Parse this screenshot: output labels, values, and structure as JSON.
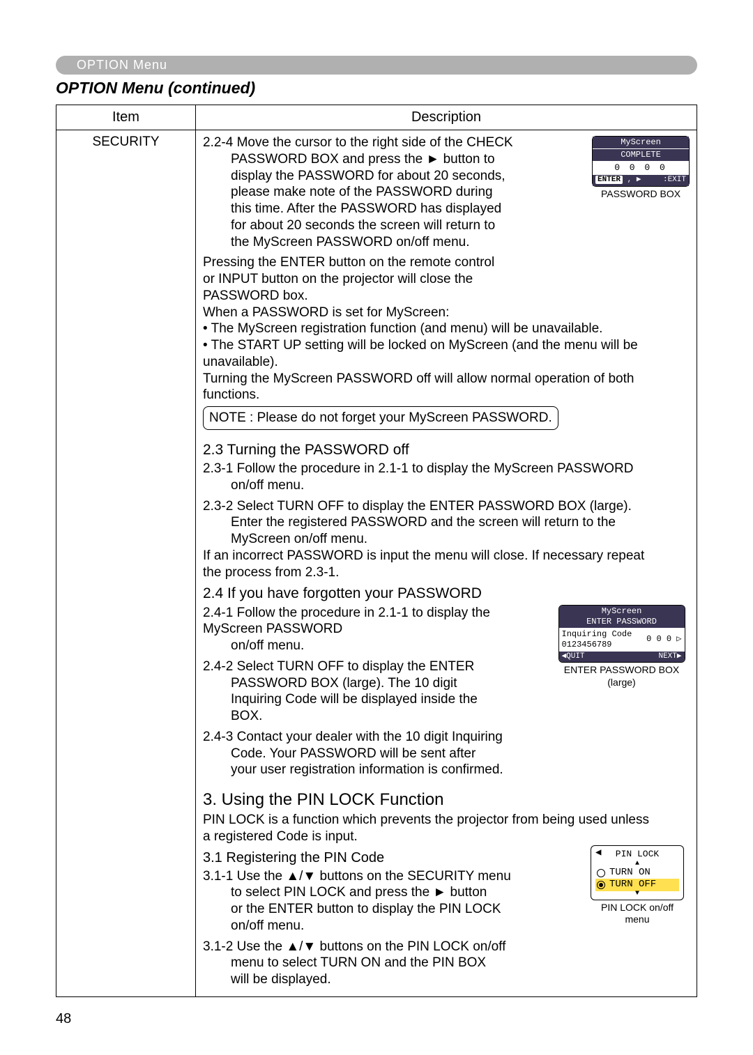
{
  "header": {
    "tab": "OPTION Menu",
    "title": "OPTION Menu (continued)"
  },
  "table": {
    "head_item": "Item",
    "head_desc": "Description",
    "item": "SECURITY"
  },
  "sec224": {
    "num": "2.2-4",
    "l1": "Move the cursor to the right side of the CHECK",
    "l2": "PASSWORD BOX and press the ► button to",
    "l3": "display the PASSWORD for about 20 seconds,",
    "l4": "please make note of the PASSWORD during",
    "l5": "this time. After the PASSWORD has displayed",
    "l6": "for about 20 seconds the screen will return to",
    "l7": "the MyScreen PASSWORD on/off menu.",
    "p2a": "Pressing the ENTER button on the remote control",
    "p2b": "or INPUT button on the projector will close the",
    "p2c": "PASSWORD box.",
    "p3": "When a PASSWORD is set for MyScreen:",
    "b1": "• The MyScreen registration function (and menu) will be unavailable.",
    "b2a": "• The START UP setting will be locked on MyScreen (and the menu will be",
    "b2b": "unavailable).",
    "p4a": "Turning the MyScreen PASSWORD off will allow normal operation of both",
    "p4b": "functions."
  },
  "note": "NOTE : Please do not forget your MyScreen PASSWORD.",
  "sec23": {
    "h": "2.3 Turning the PASSWORD off",
    "s1_num": "2.3-1",
    "s1a": "Follow the procedure in 2.1-1 to display the MyScreen PASSWORD",
    "s1b": "on/off menu.",
    "s2_num": "2.3-2",
    "s2a": "Select TURN OFF to display the ENTER PASSWORD BOX (large).",
    "s2b": "Enter the registered PASSWORD and the screen will return to the",
    "s2c": "MyScreen on/off menu.",
    "s2d": "If an incorrect PASSWORD is input the menu will close. If necessary repeat",
    "s2e": "the process from 2.3-1."
  },
  "sec24": {
    "h": "2.4 If you have forgotten your PASSWORD",
    "s1_num": "2.4-1",
    "s1a": "Follow the procedure in 2.1-1 to display the MyScreen PASSWORD",
    "s1b": "on/off menu.",
    "s2_num": "2.4-2",
    "s2a": "Select TURN OFF to display the ENTER",
    "s2b": "PASSWORD BOX (large). The 10 digit",
    "s2c": "Inquiring Code will be displayed inside the",
    "s2d": "BOX.",
    "s3_num": "2.4-3",
    "s3a": "Contact your dealer with the 10 digit Inquiring",
    "s3b": "Code. Your PASSWORD will be sent after",
    "s3c": "your user registration information is confirmed."
  },
  "sec3": {
    "h": "3. Using the PIN LOCK Function",
    "intro1": "PIN LOCK is a function which prevents the projector from being used unless",
    "intro2": "a registered Code is input.",
    "h31": "3.1 Registering the PIN Code",
    "s1_num": "3.1-1",
    "s1a": "Use the ▲/▼ buttons on the SECURITY menu",
    "s1b": "to select PIN LOCK and press the ► button",
    "s1c": "or the ENTER button to display the PIN LOCK",
    "s1d": "on/off menu.",
    "s2_num": "3.1-2",
    "s2a": "Use the ▲/▼ buttons on the PIN LOCK on/off",
    "s2b": "menu to select TURN ON and the PIN BOX",
    "s2c": "will be displayed."
  },
  "osd1": {
    "title": "MyScreen",
    "sub": "COMPLETE",
    "digits": "0  0  0  0",
    "enter": "ENTER",
    "exit": ":EXIT",
    "caption": "PASSWORD BOX"
  },
  "osd2": {
    "title": "MyScreen",
    "sub": "ENTER PASSWORD",
    "inq_lbl": "Inquiring Code",
    "inq_code": "0123456789",
    "right": "0  0  0 ▷",
    "quit": "◀QUIT",
    "next": "NEXT▶",
    "cap1": "ENTER PASSWORD BOX",
    "cap2": "(large)"
  },
  "osd3": {
    "title": "PIN LOCK",
    "on": "TURN ON",
    "off": "TURN OFF",
    "cap1": "PIN LOCK on/off",
    "cap2": "menu"
  },
  "page_num": "48"
}
